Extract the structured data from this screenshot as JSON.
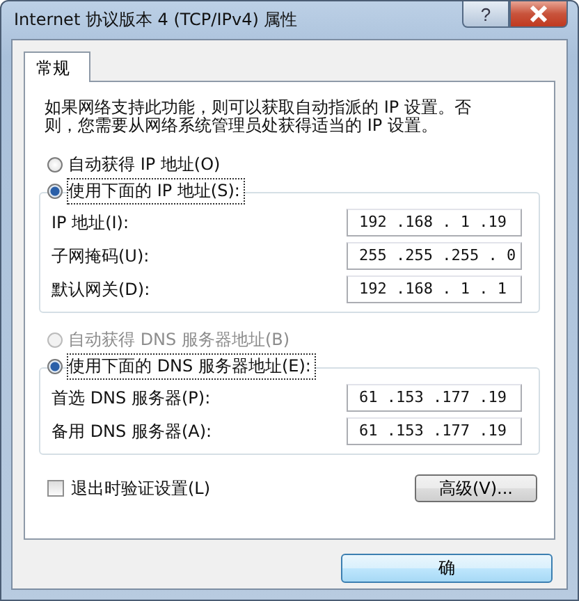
{
  "window": {
    "title": "Internet 协议版本 4 (TCP/IPv4) 属性",
    "help_button": "?"
  },
  "tabs": [
    {
      "label": "常规",
      "selected": true
    }
  ],
  "description": "如果网络支持此功能，则可以获取自动指派的 IP 设置。否则，您需要从网络系统管理员处获得适当的 IP 设置。",
  "ip_group": {
    "options": [
      {
        "label": "自动获得 IP 地址(O)",
        "selected": false,
        "disabled": false
      },
      {
        "label": "使用下面的 IP 地址(S):",
        "selected": true,
        "disabled": false
      }
    ],
    "fields": [
      {
        "label": "IP 地址(I):",
        "value": "192 .168 . 1 .19"
      },
      {
        "label": "子网掩码(U):",
        "value": "255 .255 .255 . 0"
      },
      {
        "label": "默认网关(D):",
        "value": "192 .168 . 1 . 1"
      }
    ]
  },
  "dns_group": {
    "options": [
      {
        "label": "自动获得 DNS 服务器地址(B)",
        "selected": false,
        "disabled": true
      },
      {
        "label": "使用下面的 DNS 服务器地址(E):",
        "selected": true,
        "disabled": false
      }
    ],
    "fields": [
      {
        "label": "首选 DNS 服务器(P):",
        "value": "61 .153 .177 .19"
      },
      {
        "label": "备用 DNS 服务器(A):",
        "value": "61 .153 .177 .19"
      }
    ]
  },
  "validate_checkbox": {
    "label": "退出时验证设置(L)",
    "checked": false
  },
  "advanced_button": "高级(V)...",
  "ok_button": "确"
}
